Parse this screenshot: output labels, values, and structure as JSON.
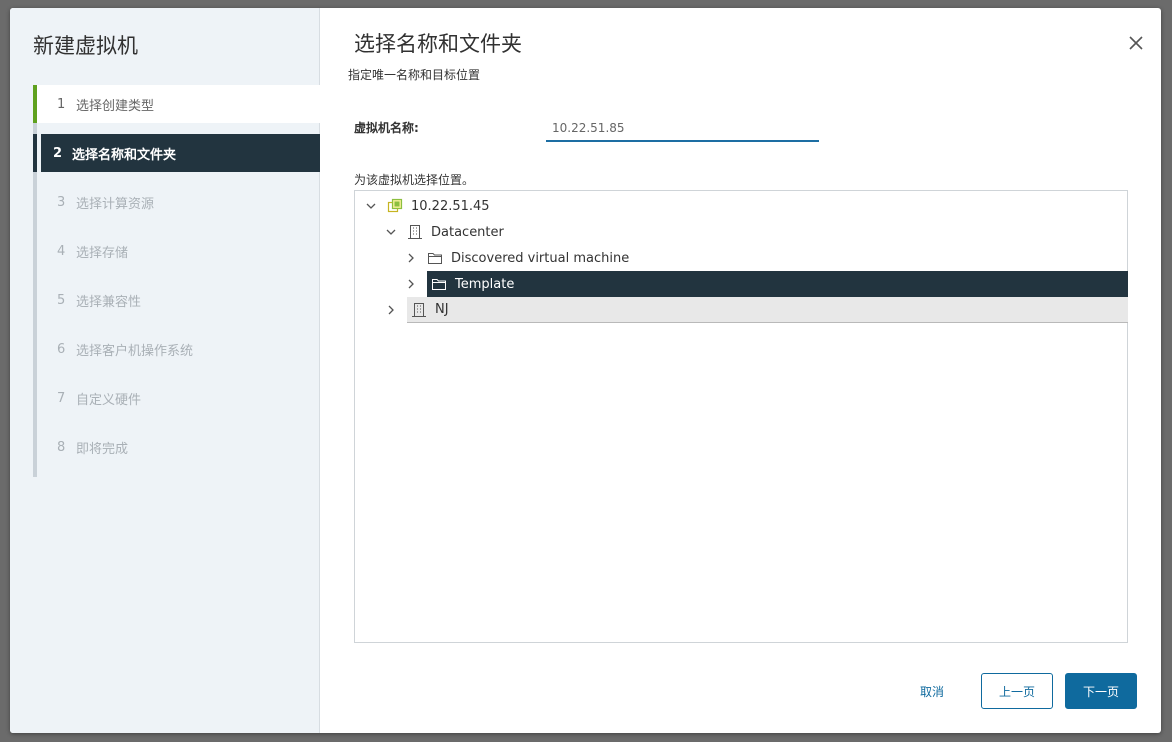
{
  "wizard": {
    "title": "新建虚拟机",
    "steps": [
      {
        "num": "1",
        "label": "选择创建类型",
        "state": "done"
      },
      {
        "num": "2",
        "label": "选择名称和文件夹",
        "state": "active"
      },
      {
        "num": "3",
        "label": "选择计算资源",
        "state": "pending"
      },
      {
        "num": "4",
        "label": "选择存储",
        "state": "pending"
      },
      {
        "num": "5",
        "label": "选择兼容性",
        "state": "pending"
      },
      {
        "num": "6",
        "label": "选择客户机操作系统",
        "state": "pending"
      },
      {
        "num": "7",
        "label": "自定义硬件",
        "state": "pending"
      },
      {
        "num": "8",
        "label": "即将完成",
        "state": "pending"
      }
    ]
  },
  "page": {
    "title": "选择名称和文件夹",
    "subtitle": "指定唯一名称和目标位置",
    "vm_name_label": "虚拟机名称:",
    "vm_name_value": "10.22.51.85",
    "location_label": "为该虚拟机选择位置。"
  },
  "tree": {
    "root": "10.22.51.45",
    "datacenter": "Datacenter",
    "folder_discovered": "Discovered virtual machine",
    "folder_template": "Template",
    "datacenter_nj": "NJ"
  },
  "footer": {
    "cancel": "取消",
    "back": "上一页",
    "next": "下一页"
  },
  "colors": {
    "nav_bg": "#eef3f7",
    "active_step_bg": "#22343f",
    "done_accent": "#5fa11f",
    "primary": "#0f6a9e",
    "selected_row_bg": "#22343f"
  }
}
